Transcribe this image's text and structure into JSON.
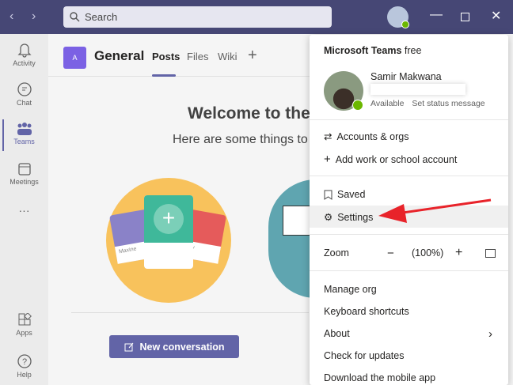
{
  "titlebar": {
    "search_placeholder": "Search"
  },
  "rail": [
    {
      "label": "Activity"
    },
    {
      "label": "Chat"
    },
    {
      "label": "Teams"
    },
    {
      "label": "Meetings"
    },
    {
      "label": "Apps"
    },
    {
      "label": "Help"
    }
  ],
  "channel": {
    "avatar": "A",
    "name": "General",
    "tabs": [
      "Posts",
      "Files",
      "Wiki"
    ]
  },
  "welcome": {
    "title": "Welcome to the",
    "subtitle": "Here are some things to",
    "card_names": [
      "Maxine",
      "Ally"
    ],
    "new_conversation": "New conversation"
  },
  "menu": {
    "app": "Microsoft Teams",
    "plan": "free",
    "user": "Samir Makwana",
    "status": "Available",
    "set_status": "Set status message",
    "items": {
      "accounts": "Accounts & orgs",
      "add_account": "Add work or school account",
      "saved": "Saved",
      "settings": "Settings",
      "zoom": "Zoom",
      "zoom_value": "(100%)",
      "manage_org": "Manage org",
      "shortcuts": "Keyboard shortcuts",
      "about": "About",
      "updates": "Check for updates",
      "download": "Download the mobile app"
    }
  },
  "colors": {
    "titlebar": "#464775",
    "accent": "#6264a7",
    "arrow": "#e8232a"
  }
}
